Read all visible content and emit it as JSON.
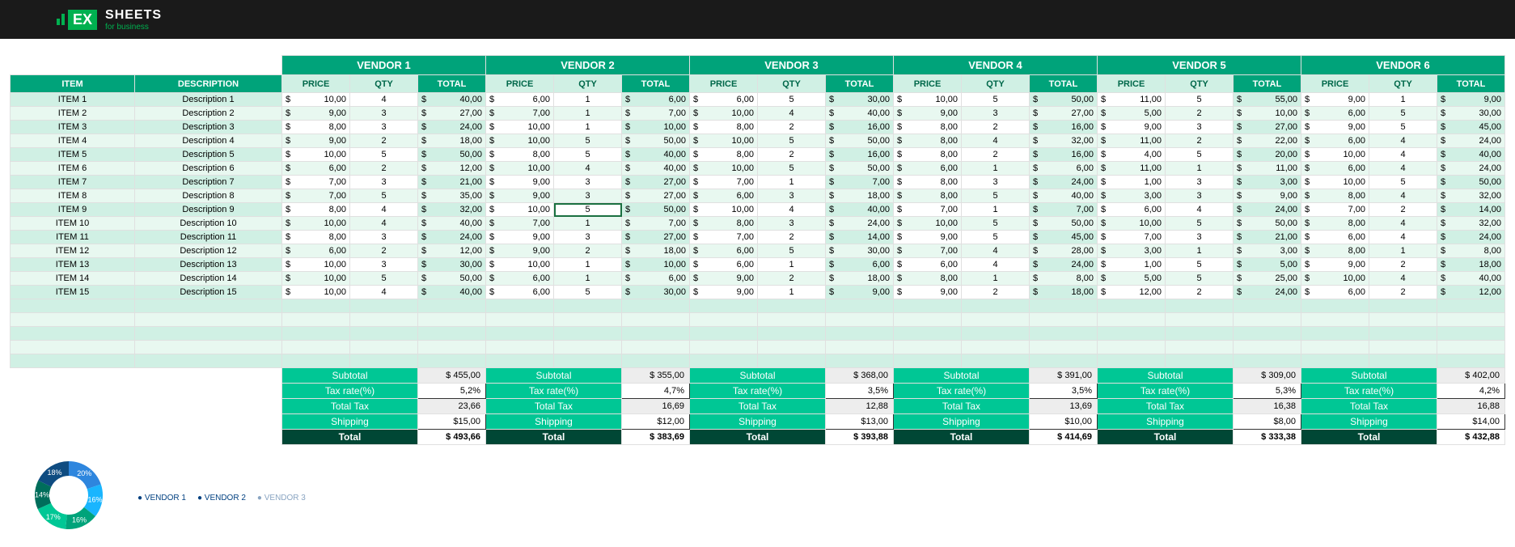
{
  "brand": {
    "ex": "EX",
    "sheets": "SHEETS",
    "sub": "for business"
  },
  "headers": {
    "item": "ITEM",
    "desc": "DESCRIPTION",
    "price": "PRICE",
    "qty": "QTY",
    "total": "TOTAL"
  },
  "vendors": [
    "VENDOR 1",
    "VENDOR 2",
    "VENDOR 3",
    "VENDOR 4",
    "VENDOR 5",
    "VENDOR 6"
  ],
  "rows": [
    {
      "item": "ITEM 1",
      "desc": "Description 1",
      "v": [
        [
          "10,00",
          "4",
          "40,00"
        ],
        [
          "6,00",
          "1",
          "6,00"
        ],
        [
          "6,00",
          "5",
          "30,00"
        ],
        [
          "10,00",
          "5",
          "50,00"
        ],
        [
          "11,00",
          "5",
          "55,00"
        ],
        [
          "9,00",
          "1",
          "9,00"
        ]
      ]
    },
    {
      "item": "ITEM 2",
      "desc": "Description 2",
      "v": [
        [
          "9,00",
          "3",
          "27,00"
        ],
        [
          "7,00",
          "1",
          "7,00"
        ],
        [
          "10,00",
          "4",
          "40,00"
        ],
        [
          "9,00",
          "3",
          "27,00"
        ],
        [
          "5,00",
          "2",
          "10,00"
        ],
        [
          "6,00",
          "5",
          "30,00"
        ]
      ]
    },
    {
      "item": "ITEM 3",
      "desc": "Description 3",
      "v": [
        [
          "8,00",
          "3",
          "24,00"
        ],
        [
          "10,00",
          "1",
          "10,00"
        ],
        [
          "8,00",
          "2",
          "16,00"
        ],
        [
          "8,00",
          "2",
          "16,00"
        ],
        [
          "9,00",
          "3",
          "27,00"
        ],
        [
          "9,00",
          "5",
          "45,00"
        ]
      ]
    },
    {
      "item": "ITEM 4",
      "desc": "Description 4",
      "v": [
        [
          "9,00",
          "2",
          "18,00"
        ],
        [
          "10,00",
          "5",
          "50,00"
        ],
        [
          "10,00",
          "5",
          "50,00"
        ],
        [
          "8,00",
          "4",
          "32,00"
        ],
        [
          "11,00",
          "2",
          "22,00"
        ],
        [
          "6,00",
          "4",
          "24,00"
        ]
      ]
    },
    {
      "item": "ITEM 5",
      "desc": "Description 5",
      "v": [
        [
          "10,00",
          "5",
          "50,00"
        ],
        [
          "8,00",
          "5",
          "40,00"
        ],
        [
          "8,00",
          "2",
          "16,00"
        ],
        [
          "8,00",
          "2",
          "16,00"
        ],
        [
          "4,00",
          "5",
          "20,00"
        ],
        [
          "10,00",
          "4",
          "40,00"
        ]
      ]
    },
    {
      "item": "ITEM 6",
      "desc": "Description 6",
      "v": [
        [
          "6,00",
          "2",
          "12,00"
        ],
        [
          "10,00",
          "4",
          "40,00"
        ],
        [
          "10,00",
          "5",
          "50,00"
        ],
        [
          "6,00",
          "1",
          "6,00"
        ],
        [
          "11,00",
          "1",
          "11,00"
        ],
        [
          "6,00",
          "4",
          "24,00"
        ]
      ]
    },
    {
      "item": "ITEM 7",
      "desc": "Description 7",
      "v": [
        [
          "7,00",
          "3",
          "21,00"
        ],
        [
          "9,00",
          "3",
          "27,00"
        ],
        [
          "7,00",
          "1",
          "7,00"
        ],
        [
          "8,00",
          "3",
          "24,00"
        ],
        [
          "1,00",
          "3",
          "3,00"
        ],
        [
          "10,00",
          "5",
          "50,00"
        ]
      ]
    },
    {
      "item": "ITEM 8",
      "desc": "Description 8",
      "v": [
        [
          "7,00",
          "5",
          "35,00"
        ],
        [
          "9,00",
          "3",
          "27,00"
        ],
        [
          "6,00",
          "3",
          "18,00"
        ],
        [
          "8,00",
          "5",
          "40,00"
        ],
        [
          "3,00",
          "3",
          "9,00"
        ],
        [
          "8,00",
          "4",
          "32,00"
        ]
      ]
    },
    {
      "item": "ITEM 9",
      "desc": "Description 9",
      "v": [
        [
          "8,00",
          "4",
          "32,00"
        ],
        [
          "10,00",
          "5",
          "50,00"
        ],
        [
          "10,00",
          "4",
          "40,00"
        ],
        [
          "7,00",
          "1",
          "7,00"
        ],
        [
          "6,00",
          "4",
          "24,00"
        ],
        [
          "7,00",
          "2",
          "14,00"
        ]
      ]
    },
    {
      "item": "ITEM 10",
      "desc": "Description 10",
      "v": [
        [
          "10,00",
          "4",
          "40,00"
        ],
        [
          "7,00",
          "1",
          "7,00"
        ],
        [
          "8,00",
          "3",
          "24,00"
        ],
        [
          "10,00",
          "5",
          "50,00"
        ],
        [
          "10,00",
          "5",
          "50,00"
        ],
        [
          "8,00",
          "4",
          "32,00"
        ]
      ]
    },
    {
      "item": "ITEM 11",
      "desc": "Description 11",
      "v": [
        [
          "8,00",
          "3",
          "24,00"
        ],
        [
          "9,00",
          "3",
          "27,00"
        ],
        [
          "7,00",
          "2",
          "14,00"
        ],
        [
          "9,00",
          "5",
          "45,00"
        ],
        [
          "7,00",
          "3",
          "21,00"
        ],
        [
          "6,00",
          "4",
          "24,00"
        ]
      ]
    },
    {
      "item": "ITEM 12",
      "desc": "Description 12",
      "v": [
        [
          "6,00",
          "2",
          "12,00"
        ],
        [
          "9,00",
          "2",
          "18,00"
        ],
        [
          "6,00",
          "5",
          "30,00"
        ],
        [
          "7,00",
          "4",
          "28,00"
        ],
        [
          "3,00",
          "1",
          "3,00"
        ],
        [
          "8,00",
          "1",
          "8,00"
        ]
      ]
    },
    {
      "item": "ITEM 13",
      "desc": "Description 13",
      "v": [
        [
          "10,00",
          "3",
          "30,00"
        ],
        [
          "10,00",
          "1",
          "10,00"
        ],
        [
          "6,00",
          "1",
          "6,00"
        ],
        [
          "6,00",
          "4",
          "24,00"
        ],
        [
          "1,00",
          "5",
          "5,00"
        ],
        [
          "9,00",
          "2",
          "18,00"
        ]
      ]
    },
    {
      "item": "ITEM 14",
      "desc": "Description 14",
      "v": [
        [
          "10,00",
          "5",
          "50,00"
        ],
        [
          "6,00",
          "1",
          "6,00"
        ],
        [
          "9,00",
          "2",
          "18,00"
        ],
        [
          "8,00",
          "1",
          "8,00"
        ],
        [
          "5,00",
          "5",
          "25,00"
        ],
        [
          "10,00",
          "4",
          "40,00"
        ]
      ]
    },
    {
      "item": "ITEM 15",
      "desc": "Description 15",
      "v": [
        [
          "10,00",
          "4",
          "40,00"
        ],
        [
          "6,00",
          "5",
          "30,00"
        ],
        [
          "9,00",
          "1",
          "9,00"
        ],
        [
          "9,00",
          "2",
          "18,00"
        ],
        [
          "12,00",
          "2",
          "24,00"
        ],
        [
          "6,00",
          "2",
          "12,00"
        ]
      ]
    }
  ],
  "summary_labels": {
    "subtotal": "Subtotal",
    "taxrate": "Tax rate(%)",
    "totaltax": "Total Tax",
    "shipping": "Shipping",
    "total": "Total"
  },
  "summary": [
    {
      "subtotal": "$   455,00",
      "taxrate": "5,2%",
      "totaltax": "23,66",
      "shipping": "$15,00",
      "total": "$ 493,66"
    },
    {
      "subtotal": "$   355,00",
      "taxrate": "4,7%",
      "totaltax": "16,69",
      "shipping": "$12,00",
      "total": "$ 383,69"
    },
    {
      "subtotal": "$   368,00",
      "taxrate": "3,5%",
      "totaltax": "12,88",
      "shipping": "$13,00",
      "total": "$ 393,88"
    },
    {
      "subtotal": "$   391,00",
      "taxrate": "3,5%",
      "totaltax": "13,69",
      "shipping": "$10,00",
      "total": "$ 414,69"
    },
    {
      "subtotal": "$   309,00",
      "taxrate": "5,3%",
      "totaltax": "16,38",
      "shipping": "$8,00",
      "total": "$ 333,38"
    },
    {
      "subtotal": "$   402,00",
      "taxrate": "4,2%",
      "totaltax": "16,88",
      "shipping": "$14,00",
      "total": "$ 432,88"
    }
  ],
  "chart_data": {
    "type": "pie",
    "categories": [
      "VENDOR 1",
      "VENDOR 2",
      "VENDOR 3",
      "VENDOR 4",
      "VENDOR 5",
      "VENDOR 6"
    ],
    "values": [
      20,
      16,
      16,
      17,
      14,
      18
    ],
    "title": "",
    "colors": [
      "#2e86de",
      "#19b5fe",
      "#00a37a",
      "#00c795",
      "#006e5b",
      "#0f4c81"
    ]
  },
  "legend": [
    "VENDOR 1",
    "VENDOR 2",
    "VENDOR 3"
  ],
  "selected_cell": {
    "row": 8,
    "vendor": 1,
    "col": "qty"
  }
}
